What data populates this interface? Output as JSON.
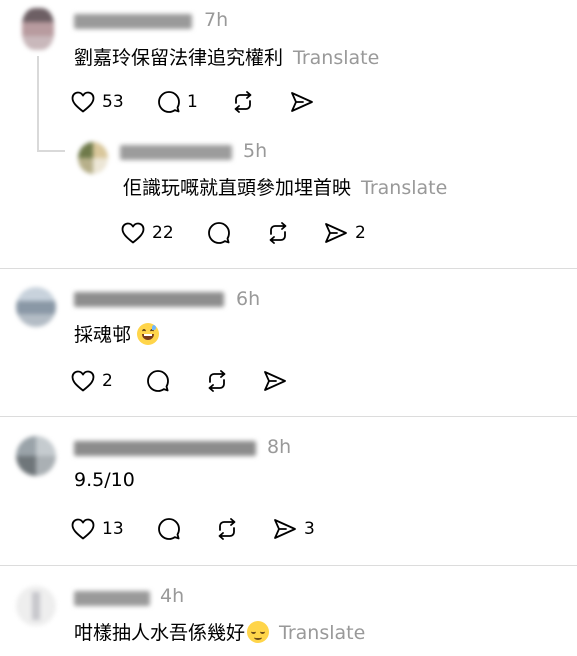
{
  "comments": [
    {
      "time": "7h",
      "text": "劉嘉玲保留法律追究權利",
      "translate": "Translate",
      "likes": "53",
      "replies": "1",
      "shares": ""
    },
    {
      "time": "5h",
      "text": "佢識玩嘅就直頭參加埋首映",
      "translate": "Translate",
      "likes": "22",
      "replies": "",
      "shares": "2"
    },
    {
      "time": "6h",
      "text": "採魂邨",
      "emoji": "grinning-sweat-emoji",
      "likes": "2",
      "replies": "",
      "shares": ""
    },
    {
      "time": "8h",
      "text": "9.5/10",
      "likes": "13",
      "replies": "",
      "shares": "3"
    },
    {
      "time": "4h",
      "text": "咁樣抽人水吾係幾好",
      "emoji": "relieved-emoji",
      "translate": "Translate"
    }
  ],
  "icons": {
    "like": "heart-icon",
    "reply": "speech-bubble-icon",
    "repost": "repost-icon",
    "share": "send-icon"
  },
  "colors": {
    "muted": "#999999",
    "divider": "#dcdcdc",
    "thread_line": "#d9d9d9"
  }
}
